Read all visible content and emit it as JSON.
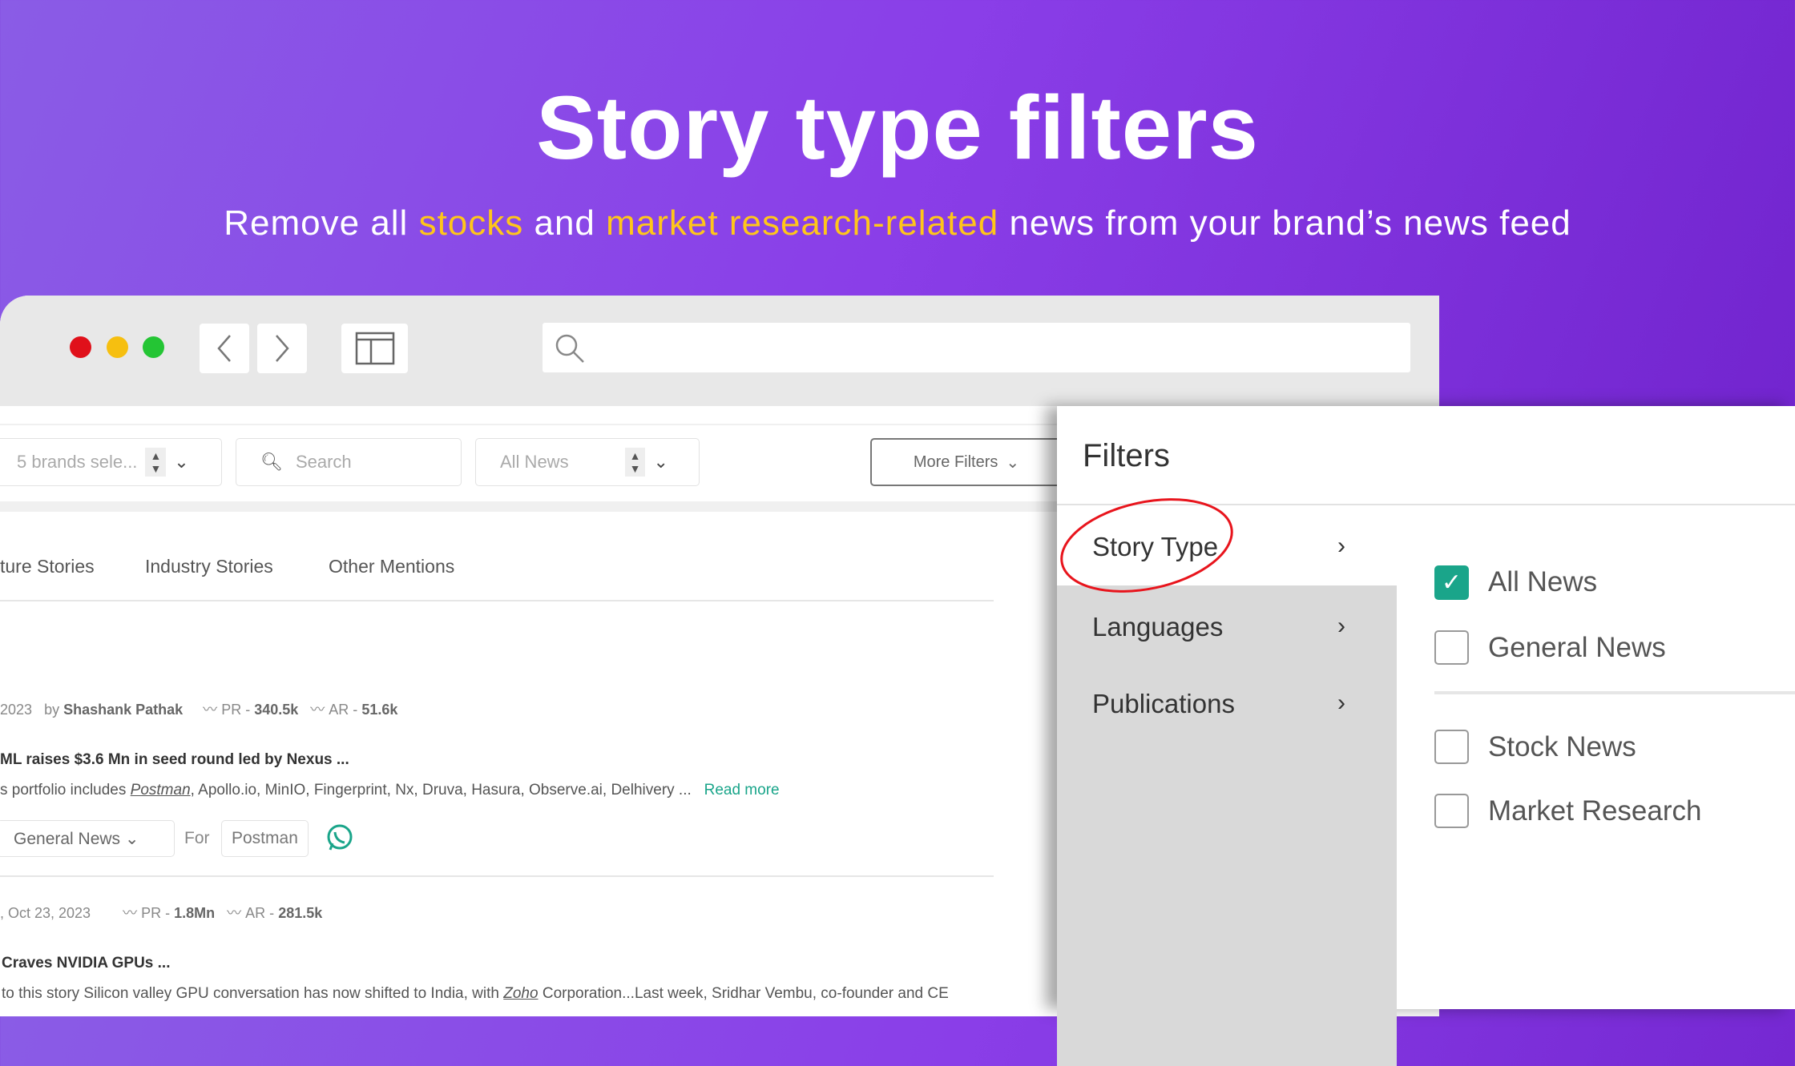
{
  "hero": {
    "title": "Story type filters",
    "subtitle_parts": [
      "Remove all ",
      "stocks",
      " and ",
      "market research-related",
      " news from your brand’s news feed"
    ],
    "highlight_color": "#ffc61a"
  },
  "browser": {
    "traffic_lights": [
      "#e0101a",
      "#f6bf10",
      "#24c534"
    ],
    "back_icon": "chevron-left",
    "forward_icon": "chevron-right",
    "sidebar_icon": "sidebar-layout",
    "search_icon": "magnifier"
  },
  "toolbar": {
    "brands_select": "5 brands sele...",
    "search_placeholder": "Search",
    "news_select": "All News",
    "more_filters": "More Filters"
  },
  "tabs": [
    "ture Stories",
    "Industry Stories",
    "Other Mentions"
  ],
  "stories": [
    {
      "date": "2023",
      "by": "by",
      "author": "Shashank Pathak",
      "pr_label": "PR - ",
      "pr": "340.5k",
      "ar_label": "AR - ",
      "ar": "51.6k",
      "headline": "ML raises $3.6 Mn in seed round led by Nexus ...",
      "snippet_pre": "s portfolio includes ",
      "snippet_link": "Postman",
      "snippet_post": ", Apollo.io, MinIO, Fingerprint, Nx, Druva, Hasura, Observe.ai, Delhivery ...",
      "read_more": "Read more",
      "tag": "General News",
      "for_label": "For",
      "brand": "Postman"
    },
    {
      "date": ", Oct 23, 2023",
      "pr_label": "PR - ",
      "pr": "1.8Mn",
      "ar_label": "AR - ",
      "ar": "281.5k",
      "headline": "Craves NVIDIA GPUs ...",
      "snippet_pre": "to this story Silicon valley GPU conversation has now shifted to India, with ",
      "snippet_link": "Zoho",
      "snippet_post": " Corporation...Last week, Sridhar Vembu, co-founder and CE"
    }
  ],
  "filters": {
    "title": "Filters",
    "menu": [
      {
        "label": "Story Type",
        "active": true
      },
      {
        "label": "Languages"
      },
      {
        "label": "Publications"
      }
    ],
    "options": [
      {
        "label": "All News",
        "checked": true
      },
      {
        "label": "General News",
        "checked": false
      },
      {
        "label": "Stock News",
        "checked": false
      },
      {
        "label": "Market Research",
        "checked": false
      }
    ],
    "accent": "#1aa58a",
    "annotation_color": "#e8141c"
  }
}
